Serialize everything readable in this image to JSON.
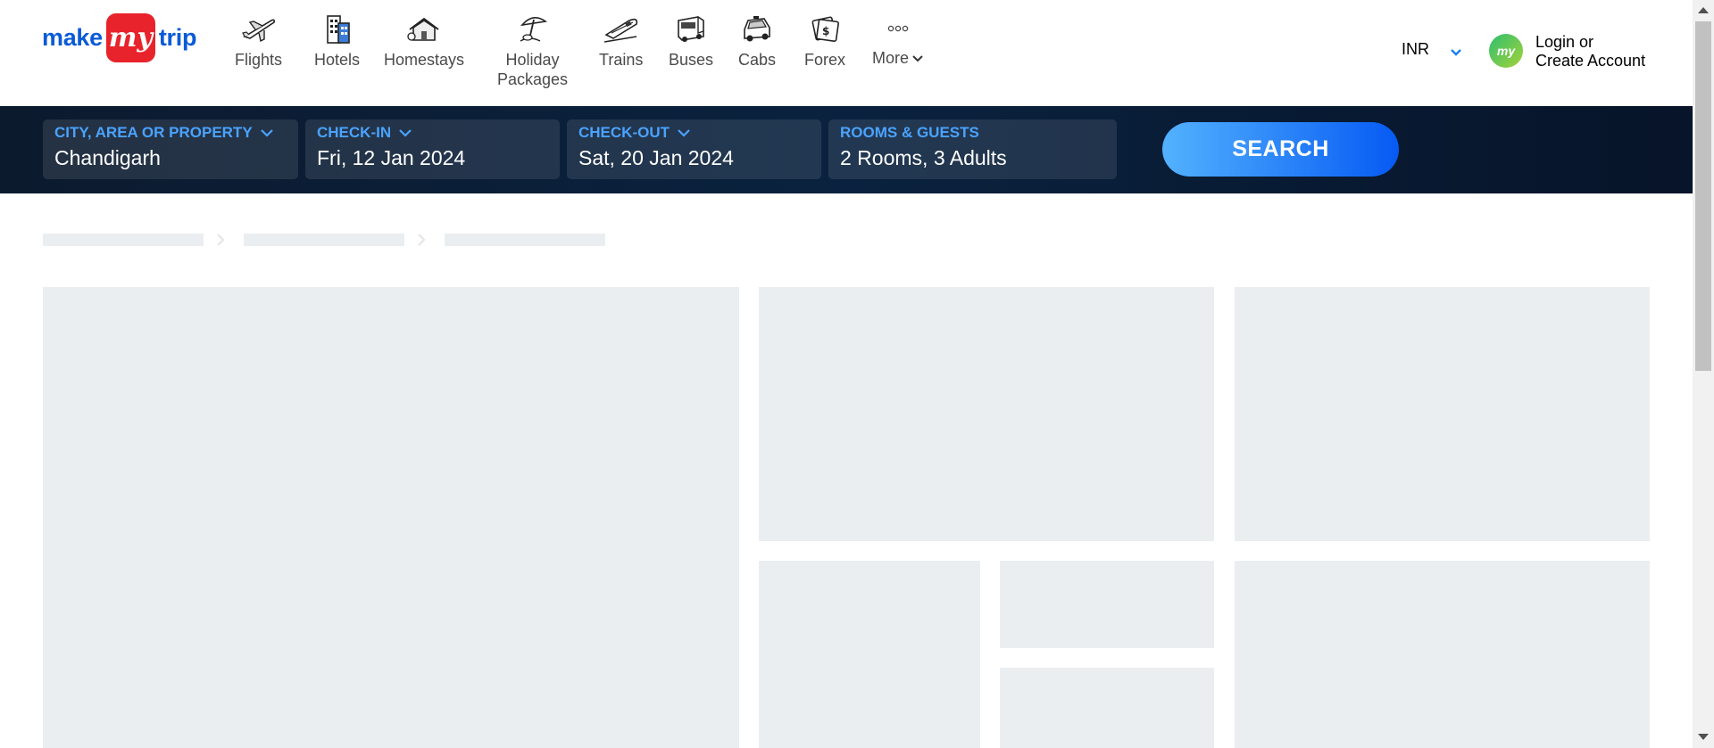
{
  "brand": {
    "make": "make",
    "my": "my",
    "trip": "trip"
  },
  "nav": {
    "flights": "Flights",
    "hotels": "Hotels",
    "homestays": "Homestays",
    "holiday_line1": "Holiday",
    "holiday_line2": "Packages",
    "trains": "Trains",
    "buses": "Buses",
    "cabs": "Cabs",
    "forex": "Forex",
    "more": "More"
  },
  "account": {
    "currency": "INR",
    "avatar_text": "my",
    "login_line1": "Login or",
    "login_line2": "Create Account"
  },
  "search": {
    "city_label": "CITY, AREA OR PROPERTY",
    "city_value": "Chandigarh",
    "checkin_label": "CHECK-IN",
    "checkin_value": "Fri, 12 Jan 2024",
    "checkout_label": "CHECK-OUT",
    "checkout_value": "Sat, 20 Jan 2024",
    "rooms_label": "ROOMS & GUESTS",
    "rooms_value": "2 Rooms, 3 Adults",
    "button": "SEARCH"
  },
  "colors": {
    "brand_blue": "#0a5bd7",
    "brand_red": "#e8232b",
    "label_blue": "#4aa3ff",
    "skeleton": "#ebeef1"
  }
}
